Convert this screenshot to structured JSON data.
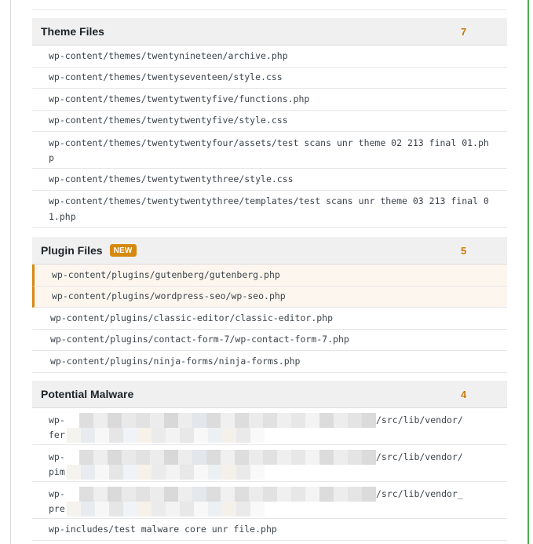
{
  "top_partial_text": "",
  "sections": [
    {
      "title": "Theme Files",
      "count": "7",
      "badge": "",
      "files": [
        "wp-content/themes/twentynineteen/archive.php",
        "wp-content/themes/twentyseventeen/style.css",
        "wp-content/themes/twentytwentyfive/functions.php",
        "wp-content/themes/twentytwentyfive/style.css",
        "wp-content/themes/twentytwentyfour/assets/test scans unr theme 02 213 final 01.php",
        "wp-content/themes/twentytwentythree/style.css",
        "wp-content/themes/twentytwentythree/templates/test scans unr theme 03 213 final 01.php"
      ]
    },
    {
      "title": "Plugin Files",
      "count": "5",
      "badge": "NEW",
      "files": [
        "wp-content/plugins/gutenberg/gutenberg.php",
        "wp-content/plugins/wordpress-seo/wp-seo.php",
        "wp-content/plugins/classic-editor/classic-editor.php",
        "wp-content/plugins/contact-form-7/wp-contact-form-7.php",
        "wp-content/plugins/ninja-forms/ninja-forms.php"
      ]
    },
    {
      "title": "Potential Malware",
      "count": "4",
      "badge": "",
      "files": [
        {
          "prefix": "wp-",
          "suffix": "/src/lib/vendor/",
          "line2": "fer"
        },
        {
          "prefix": "wp-",
          "suffix": "/src/lib/vendor/",
          "line2": "pim"
        },
        {
          "prefix": "wp-",
          "suffix": "/src/lib/vendor_",
          "line2": "pre"
        },
        "wp-includes/test malware core unr file.php"
      ]
    }
  ],
  "colors": {
    "accent": "#d6890f",
    "count": "#c77a05",
    "header_bg": "#f0f0f1",
    "highlight_bg": "#fdf6ee",
    "frame_right": "#4caf50"
  }
}
